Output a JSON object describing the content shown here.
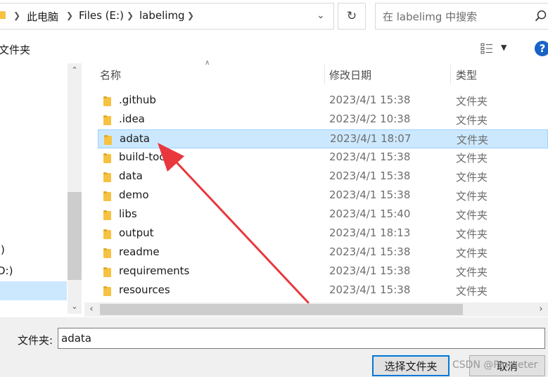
{
  "address": {
    "breadcrumbs": [
      "此电脑",
      "Files (E:)",
      "labelimg"
    ],
    "search_placeholder": "在 labelimg 中搜索"
  },
  "toolbar": {
    "location_label": "文件夹"
  },
  "nav": {
    "items": [
      {
        "label": ":)"
      },
      {
        "label": "D:)"
      }
    ]
  },
  "columns": {
    "name": "名称",
    "date": "修改日期",
    "type": "类型"
  },
  "files": [
    {
      "name": ".github",
      "date": "2023/4/1 15:38",
      "type": "文件夹"
    },
    {
      "name": ".idea",
      "date": "2023/4/2 10:38",
      "type": "文件夹"
    },
    {
      "name": "adata",
      "date": "2023/4/1 18:07",
      "type": "文件夹"
    },
    {
      "name": "build-tools",
      "date": "2023/4/1 15:38",
      "type": "文件夹"
    },
    {
      "name": "data",
      "date": "2023/4/1 15:38",
      "type": "文件夹"
    },
    {
      "name": "demo",
      "date": "2023/4/1 15:38",
      "type": "文件夹"
    },
    {
      "name": "libs",
      "date": "2023/4/1 15:40",
      "type": "文件夹"
    },
    {
      "name": "output",
      "date": "2023/4/1 18:13",
      "type": "文件夹"
    },
    {
      "name": "readme",
      "date": "2023/4/1 15:38",
      "type": "文件夹"
    },
    {
      "name": "requirements",
      "date": "2023/4/1 15:38",
      "type": "文件夹"
    },
    {
      "name": "resources",
      "date": "2023/4/1 15:38",
      "type": "文件夹"
    }
  ],
  "selected_index": 2,
  "footer": {
    "folder_label": "文件夹:",
    "folder_value": "adata",
    "select_button": "选择文件夹",
    "cancel_button": "取消",
    "watermark": "CSDN @Pinmeter"
  },
  "colors": {
    "selection": "#cce8ff",
    "folder": "#f5c242",
    "accent": "#0078d7",
    "arrow": "#e8383d"
  }
}
